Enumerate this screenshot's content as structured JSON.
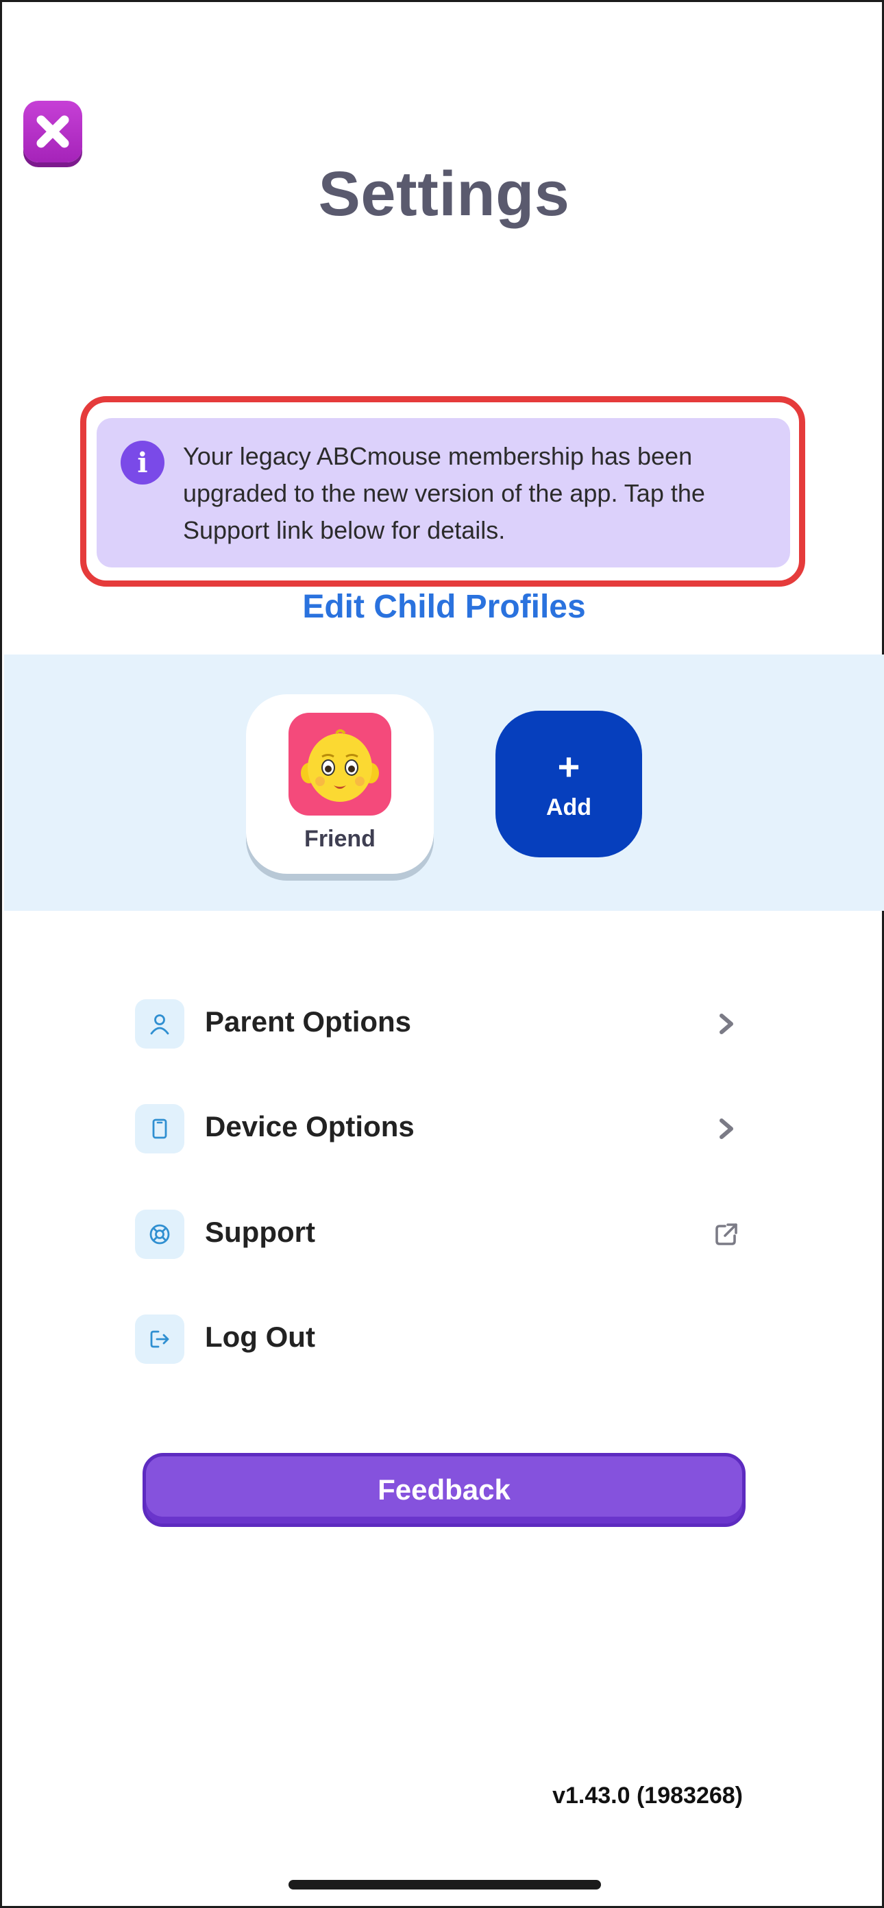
{
  "header": {
    "title": "Settings",
    "close_icon": "close-icon"
  },
  "banner": {
    "icon": "info-icon",
    "icon_glyph": "i",
    "text": "Your legacy ABCmouse membership has been upgraded to the new version of the app. Tap the Support link below for details."
  },
  "profiles": {
    "heading": "Edit Child Profiles",
    "items": [
      {
        "name": "Friend",
        "avatar": "baby-avatar"
      }
    ],
    "add_plus": "+",
    "add_label": "Add"
  },
  "menu": {
    "items": [
      {
        "label": "Parent Options",
        "icon": "person-icon",
        "trail": "chevron-right-icon"
      },
      {
        "label": "Device Options",
        "icon": "device-icon",
        "trail": "chevron-right-icon"
      },
      {
        "label": "Support",
        "icon": "lifebuoy-icon",
        "trail": "external-link-icon"
      },
      {
        "label": "Log Out",
        "icon": "logout-icon",
        "trail": ""
      }
    ]
  },
  "feedback": {
    "label": "Feedback"
  },
  "footer": {
    "version": "v1.43.0 (1983268)"
  },
  "colors": {
    "accent_purple": "#8552dd",
    "close_magenta": "#b52fc8",
    "link_blue": "#2a72de",
    "add_blue": "#063fbd",
    "banner_bg": "#dcd1fb",
    "banner_outline": "#e53b3b",
    "band_bg": "#e5f2fc",
    "avatar_pink": "#f44a7b"
  }
}
